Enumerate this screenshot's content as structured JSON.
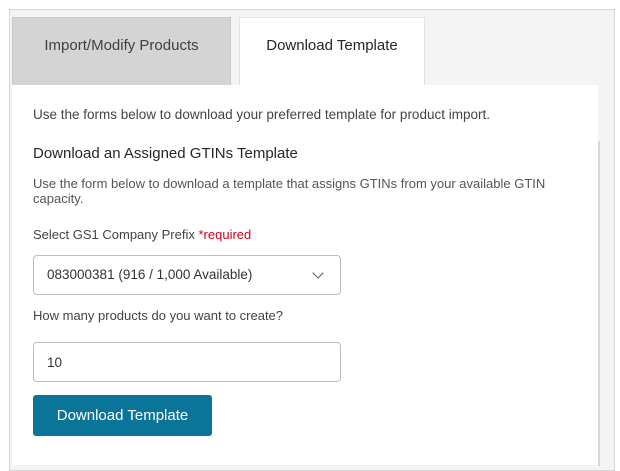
{
  "tabs": [
    {
      "label": "Import/Modify Products",
      "active": false
    },
    {
      "label": "Download Template",
      "active": true
    }
  ],
  "panel": {
    "intro": "Use the forms below to download your preferred template for product import.",
    "section_title": "Download an Assigned GTINs Template",
    "section_description": "Use the form below to download a template that assigns GTINs from your available GTIN capacity.",
    "prefix_label": "Select GS1 Company Prefix",
    "required_text": "*required",
    "prefix_selected": "083000381 (916 / 1,000 Available)",
    "count_label": "How many products do you want to create?",
    "count_value": "10",
    "download_button": "Download Template"
  },
  "icons": {
    "select_chevron": "chevron-down-icon"
  },
  "colors": {
    "primary_button": "#0b7599",
    "required": "#d0021b",
    "active_tab": "#ffffff",
    "inactive_tab": "#d4d4d4"
  }
}
